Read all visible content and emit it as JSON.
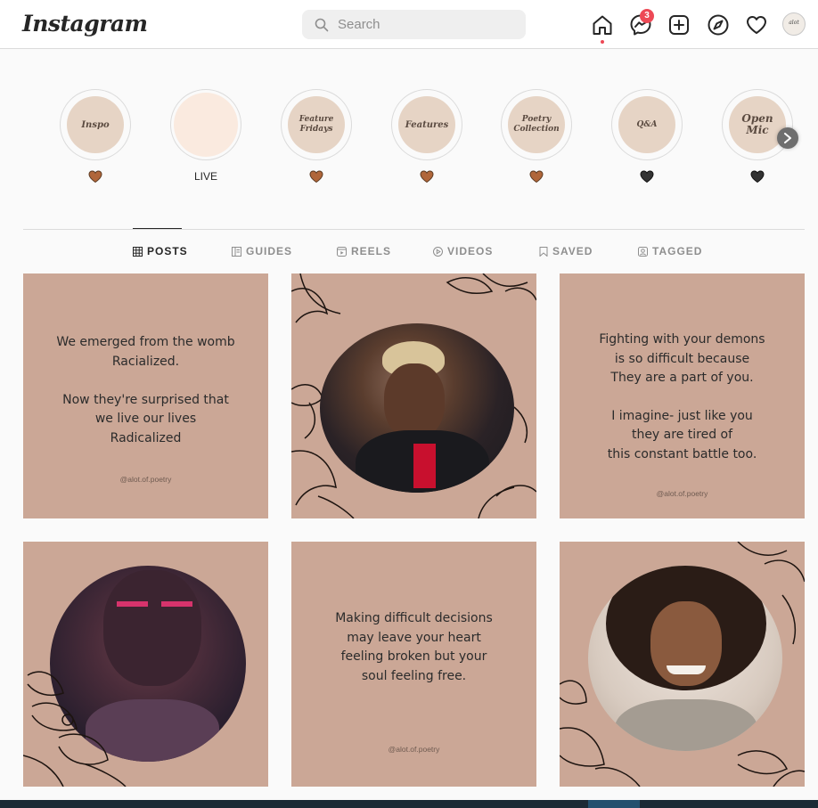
{
  "app": {
    "logo": "Instagram"
  },
  "search": {
    "placeholder": "Search"
  },
  "nav": {
    "icons": [
      "home-icon",
      "messenger-icon",
      "new-post-icon",
      "explore-icon",
      "activity-heart-icon",
      "profile-avatar"
    ],
    "messages_badge": "3",
    "avatar_text": "alot"
  },
  "highlights": [
    {
      "title": "Inspo",
      "label": "",
      "heart_color": "#a0522d"
    },
    {
      "title": "",
      "label": "LIVE",
      "heart_color": ""
    },
    {
      "title": "Feature Fridays",
      "label": "",
      "heart_color": "#a0522d"
    },
    {
      "title": "Features",
      "label": "",
      "heart_color": "#a0522d"
    },
    {
      "title": "Poetry Collection",
      "label": "",
      "heart_color": "#a0522d"
    },
    {
      "title": "Q&A",
      "label": "",
      "heart_color": "#333333"
    },
    {
      "title": "Open Mic",
      "label": "",
      "heart_color": "#333333"
    }
  ],
  "tabs": [
    {
      "label": "POSTS",
      "icon": "grid-icon",
      "active": true
    },
    {
      "label": "GUIDES",
      "icon": "guides-icon",
      "active": false
    },
    {
      "label": "REELS",
      "icon": "reels-icon",
      "active": false
    },
    {
      "label": "VIDEOS",
      "icon": "videos-icon",
      "active": false
    },
    {
      "label": "SAVED",
      "icon": "bookmark-icon",
      "active": false
    },
    {
      "label": "TAGGED",
      "icon": "tagged-icon",
      "active": false
    }
  ],
  "posts": [
    {
      "type": "quote",
      "lines": [
        "We emerged from the womb",
        "Racialized.",
        "",
        "Now they're surprised that",
        "we live our lives",
        "Radicalized"
      ],
      "handle": "@alot.of.poetry"
    },
    {
      "type": "photo",
      "alt": "portrait with floral outline"
    },
    {
      "type": "quote",
      "lines": [
        "Fighting with your demons",
        "is so difficult because",
        "They are a part of you.",
        "",
        "I imagine- just like you",
        "they are tired of",
        "this constant battle too."
      ],
      "handle": "@alot.of.poetry"
    },
    {
      "type": "photo",
      "alt": "painted face portrait with floral outline"
    },
    {
      "type": "quote",
      "lines": [
        "Making difficult decisions",
        "may leave your heart",
        "feeling broken but your",
        "soul feeling free."
      ],
      "handle": "@alot.of.poetry"
    },
    {
      "type": "photo",
      "alt": "smiling portrait with floral outline"
    }
  ],
  "colors": {
    "post_background": "#cba796",
    "highlight_fill": "#e6d4c5",
    "live_fill": "#faeadf",
    "notification": "#ed4956"
  }
}
